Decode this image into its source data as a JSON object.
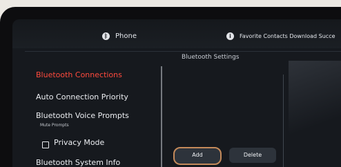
{
  "tabs": [
    {
      "label": "Phone",
      "icon": "bluetooth-icon"
    },
    {
      "label": "Favorite Contacts Download Succe",
      "icon": "info-icon"
    }
  ],
  "page_title": "Bluetooth Settings",
  "menu": [
    {
      "label": "Bluetooth Connections",
      "active": true
    },
    {
      "label": "Auto Connection Priority",
      "active": false
    },
    {
      "label": "Bluetooth Voice Prompts",
      "active": false,
      "sub": "Mute Prompts"
    },
    {
      "label": "Privacy Mode",
      "active": false,
      "checked": false
    },
    {
      "label": "Bluetooth System Info",
      "active": false
    }
  ],
  "buttons": {
    "add": "Add",
    "delete": "Delete"
  },
  "colors": {
    "active": "#ff4a3d",
    "highlight_ring": "#c48a5a"
  }
}
